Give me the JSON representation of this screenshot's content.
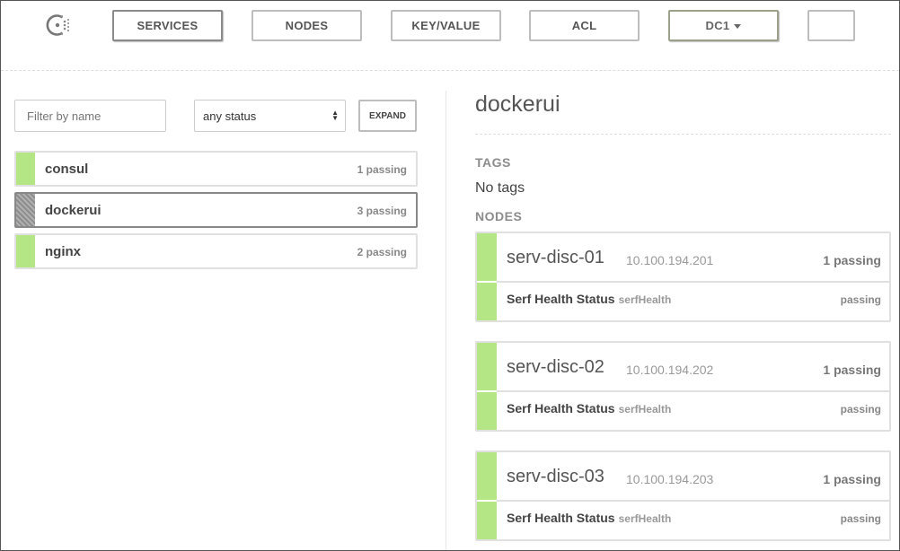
{
  "nav": {
    "items": [
      "SERVICES",
      "NODES",
      "KEY/VALUE",
      "ACL"
    ],
    "datacenter": "DC1",
    "extra_label": ""
  },
  "filter": {
    "placeholder": "Filter by name",
    "status_value": "any status",
    "expand_label": "EXPAND"
  },
  "services": [
    {
      "name": "consul",
      "count": "1 passing",
      "status_color": "#b5e686"
    },
    {
      "name": "dockerui",
      "count": "3 passing",
      "status_color": "#9a9a9a",
      "selected": true
    },
    {
      "name": "nginx",
      "count": "2 passing",
      "status_color": "#b5e686"
    }
  ],
  "detail": {
    "title": "dockerui",
    "tags_label": "TAGS",
    "tags_value": "No tags",
    "nodes_label": "NODES",
    "nodes": [
      {
        "name": "serv-disc-01",
        "address": "10.100.194.201",
        "count": "1 passing",
        "check_name": "Serf Health Status",
        "check_id": "serfHealth",
        "check_status": "passing"
      },
      {
        "name": "serv-disc-02",
        "address": "10.100.194.202",
        "count": "1 passing",
        "check_name": "Serf Health Status",
        "check_id": "serfHealth",
        "check_status": "passing"
      },
      {
        "name": "serv-disc-03",
        "address": "10.100.194.203",
        "count": "1 passing",
        "check_name": "Serf Health Status",
        "check_id": "serfHealth",
        "check_status": "passing"
      }
    ]
  },
  "colors": {
    "passing": "#b5e686",
    "selected_bar": "#9a9a9a",
    "border": "#e0e0e0"
  },
  "icons": {
    "logo": "consul-logo-icon",
    "dropdown": "caret-down-icon",
    "select": "select-arrows-icon"
  }
}
